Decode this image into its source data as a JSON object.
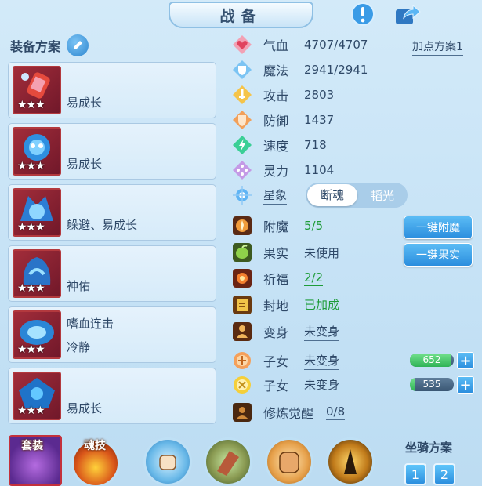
{
  "header": {
    "title": "战备"
  },
  "equip": {
    "heading": "装备方案"
  },
  "pets": [
    {
      "line1": "易成长",
      "line2": ""
    },
    {
      "line1": "易成长",
      "line2": ""
    },
    {
      "line1": "躲避、易成长",
      "line2": ""
    },
    {
      "line1": "神佑",
      "line2": ""
    },
    {
      "line1": "嗜血连击",
      "line2": "冷静"
    },
    {
      "line1": "易成长",
      "line2": ""
    }
  ],
  "stars": "★★★",
  "stats": {
    "hp": {
      "label": "气血",
      "value": "4707/4707"
    },
    "mp": {
      "label": "魔法",
      "value": "2941/2941"
    },
    "atk": {
      "label": "攻击",
      "value": "2803"
    },
    "def": {
      "label": "防御",
      "value": "1437"
    },
    "spd": {
      "label": "速度",
      "value": "718"
    },
    "spi": {
      "label": "灵力",
      "value": "1104"
    }
  },
  "point_plan": "加点方案1",
  "star_sign": {
    "label": "星象",
    "options": [
      "断魂",
      "韬光"
    ],
    "selected": "断魂"
  },
  "enchant": {
    "label": "附魔",
    "value": "5/5",
    "button": "一键附魔"
  },
  "fruit": {
    "label": "果实",
    "value": "未使用",
    "button": "一键果实"
  },
  "pray": {
    "label": "祈福",
    "value": "2/2"
  },
  "fief": {
    "label": "封地",
    "value": "已加成"
  },
  "transform": {
    "label": "变身",
    "value": "未变身"
  },
  "child1": {
    "label": "子女",
    "value": "未变身",
    "bar_value": "652",
    "fill": 0.95
  },
  "child2": {
    "label": "子女",
    "value": "未变身",
    "bar_value": "535",
    "fill": 0.1
  },
  "cultivate": {
    "label": "修炼觉醒",
    "value": "0/8"
  },
  "bottom": {
    "suit_label": "套装",
    "soul_label": "魂技",
    "mount_title": "坐骑方案",
    "mount_buttons": [
      "1",
      "2"
    ]
  },
  "colors": {
    "accent_blue": "#2b8ede",
    "green_value": "#1e9c39",
    "text_dark": "#2f4968",
    "portrait_frame": "#b3393e"
  }
}
